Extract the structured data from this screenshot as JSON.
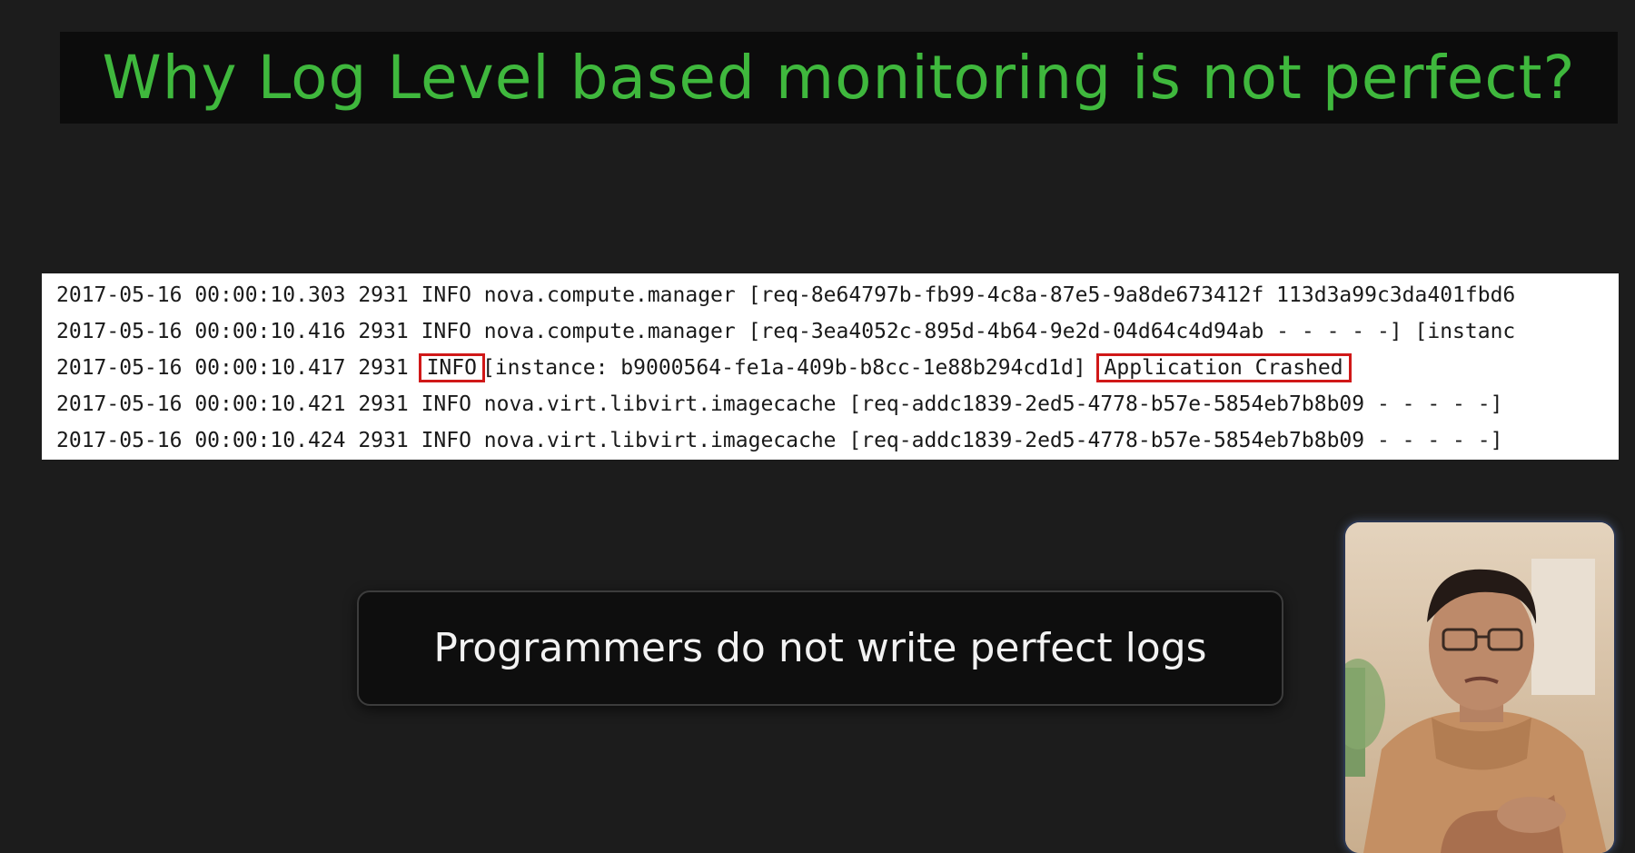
{
  "slide": {
    "title": "Why Log Level based monitoring is not perfect?",
    "caption": "Programmers do not write perfect logs"
  },
  "log": {
    "lines": [
      "2017-05-16 00:00:10.303 2931 INFO nova.compute.manager [req-8e64797b-fb99-4c8a-87e5-9a8de673412f 113d3a99c3da401fbd6",
      "2017-05-16 00:00:10.416 2931 INFO nova.compute.manager [req-3ea4052c-895d-4b64-9e2d-04d64c4d94ab - - - - -] [instanc",
      {
        "prefix": "2017-05-16 00:00:10.417 2931 ",
        "level": "INFO",
        "middle": "[instance: b9000564-fe1a-409b-b8cc-1e88b294cd1d]",
        "message": "Application Crashed"
      },
      "2017-05-16 00:00:10.421 2931 INFO nova.virt.libvirt.imagecache [req-addc1839-2ed5-4778-b57e-5854eb7b8b09 - - - - -]",
      "2017-05-16 00:00:10.424 2931 INFO nova.virt.libvirt.imagecache [req-addc1839-2ed5-4778-b57e-5854eb7b8b09 - - - - -]"
    ],
    "highlight_color": "#d01818"
  },
  "colors": {
    "background": "#1c1c1c",
    "title_bar": "#0c0c0c",
    "title_text": "#3fb83d",
    "caption_text": "#f2f2f2"
  },
  "icons": {
    "presenter": "presenter-webcam-icon"
  }
}
